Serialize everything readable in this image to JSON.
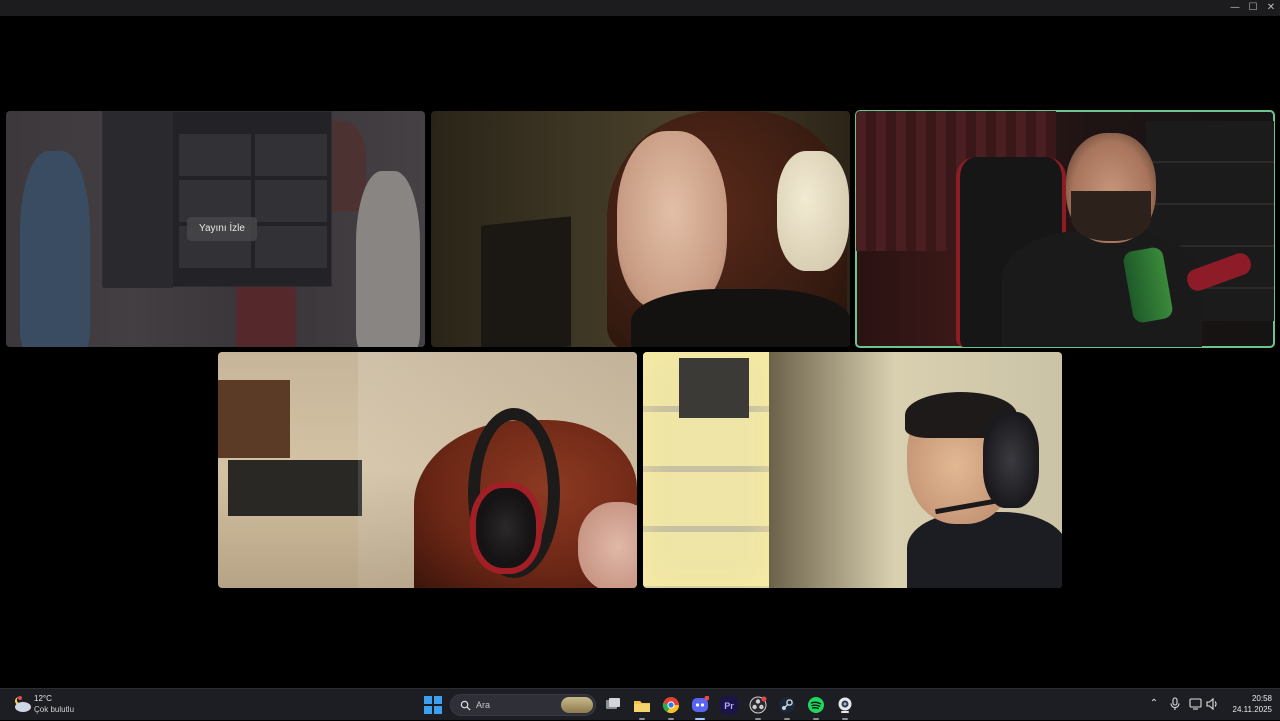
{
  "window": {
    "controls": {
      "minimize": "—",
      "maximize": "☐",
      "close": "✕"
    }
  },
  "call": {
    "tiles": [
      {
        "kind": "stream-preview",
        "watch_label": "Yayını İzle",
        "dimmed": true
      },
      {
        "kind": "camera",
        "speaking": false
      },
      {
        "kind": "camera",
        "speaking": true
      },
      {
        "kind": "camera",
        "speaking": false
      },
      {
        "kind": "camera",
        "speaking": false
      }
    ],
    "speaking_color": "#6cc48e"
  },
  "taskbar": {
    "weather": {
      "temperature": "12°C",
      "condition": "Çok bulutlu",
      "icon": "cloud-night-icon"
    },
    "search": {
      "placeholder": "Ara",
      "icon": "search-icon"
    },
    "apps": [
      {
        "name": "start",
        "icon": "windows-logo-icon"
      },
      {
        "name": "task-view",
        "icon": "task-view-icon"
      },
      {
        "name": "file-explorer",
        "icon": "folder-icon"
      },
      {
        "name": "chrome",
        "icon": "chrome-icon"
      },
      {
        "name": "discord",
        "icon": "discord-icon"
      },
      {
        "name": "premiere-pro",
        "icon": "premiere-icon",
        "label": "Pr"
      },
      {
        "name": "obs",
        "icon": "obs-icon"
      },
      {
        "name": "steam",
        "icon": "steam-icon"
      },
      {
        "name": "spotify",
        "icon": "spotify-icon"
      },
      {
        "name": "webcam-app",
        "icon": "webcam-icon"
      }
    ],
    "tray": {
      "overflow": "⌃",
      "mic": "🎙",
      "network": "🖥",
      "volume": "🔊"
    },
    "clock": {
      "time": "20:58",
      "date": "24.11.2025"
    },
    "accent": "#3aa0ef"
  }
}
